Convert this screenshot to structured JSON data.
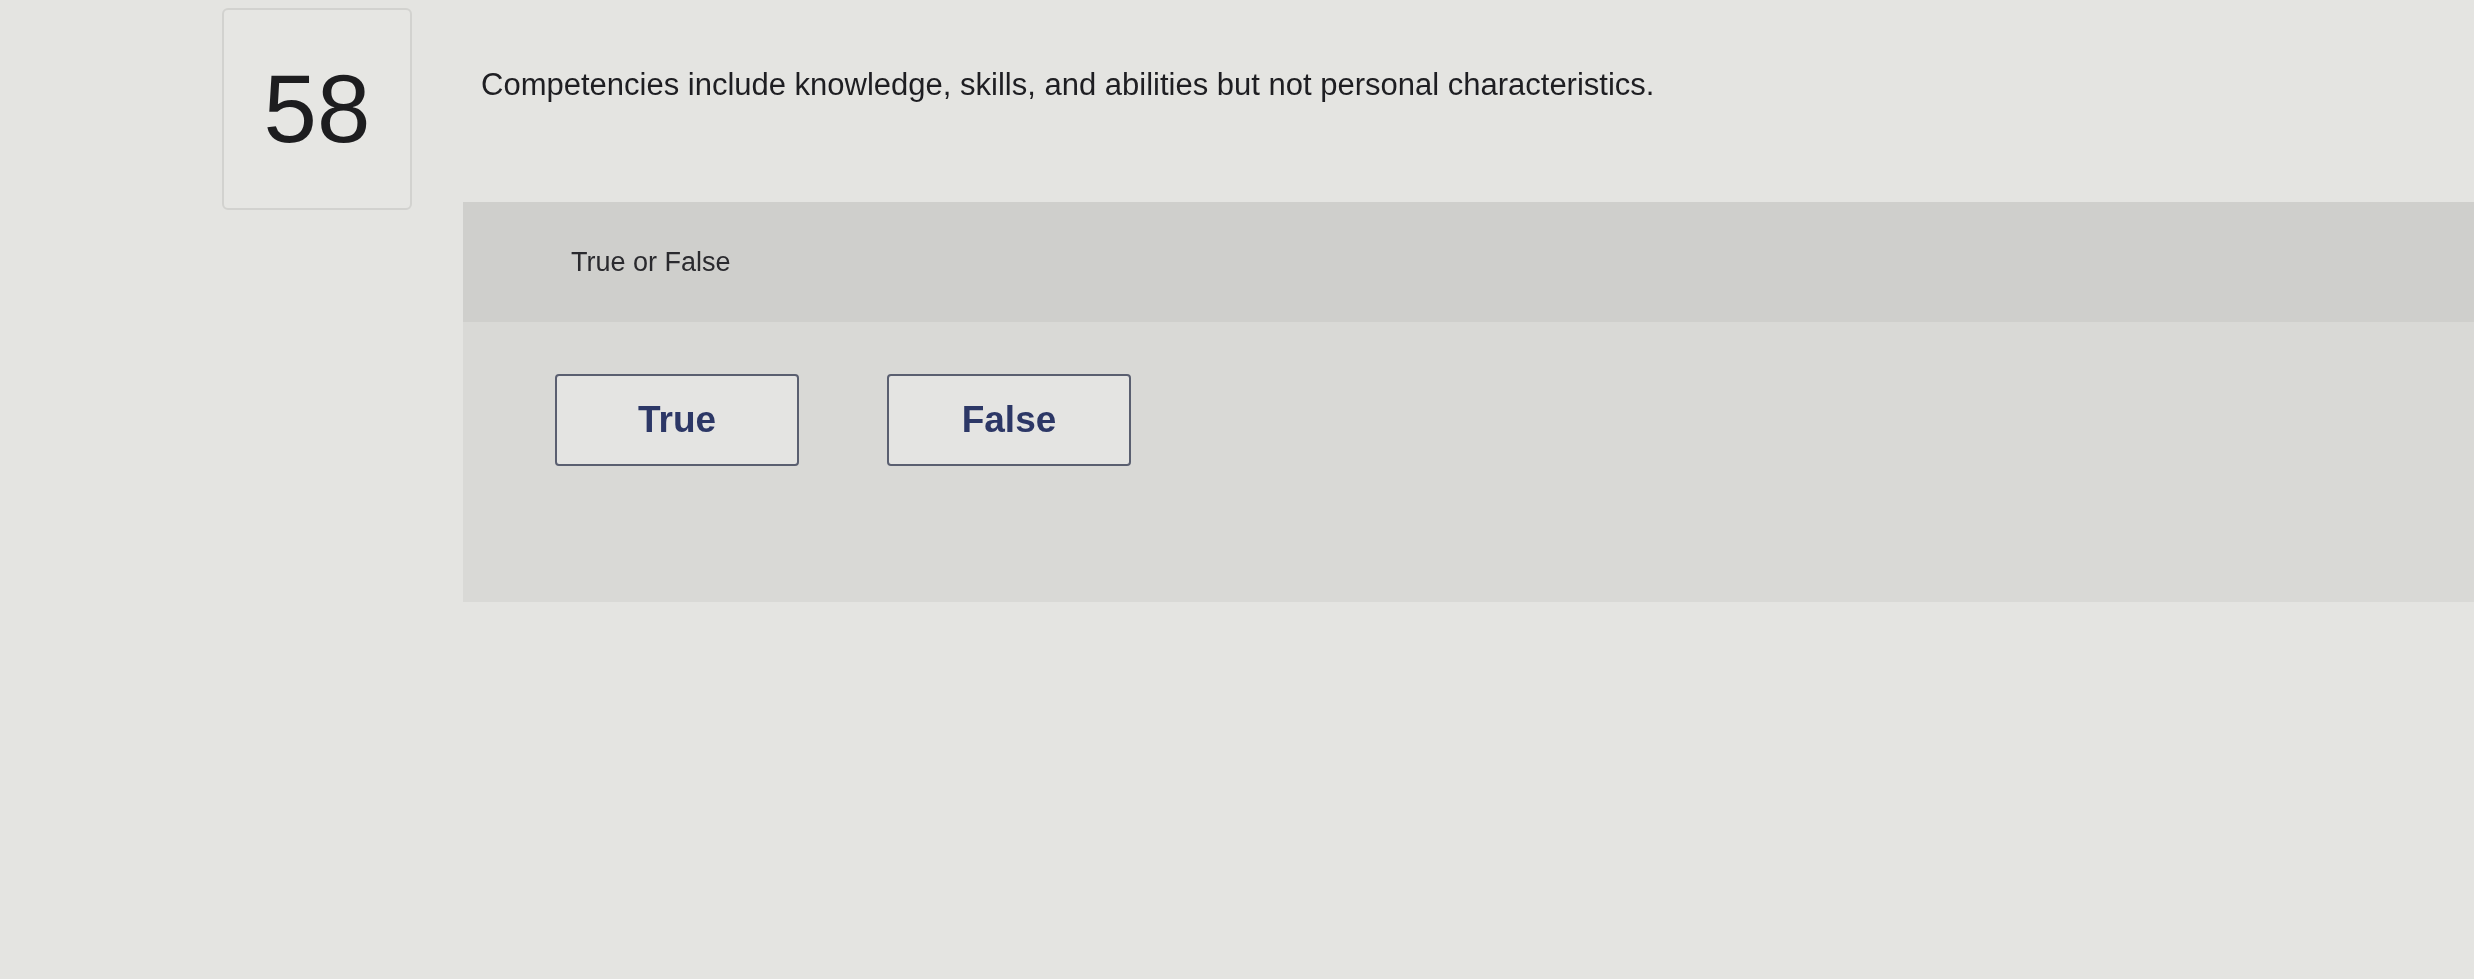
{
  "question": {
    "number": "58",
    "text": "Competencies include knowledge, skills, and abilities but not personal characteristics."
  },
  "answer_panel": {
    "prompt": "True or False",
    "options": [
      {
        "label": "True",
        "selected": false
      },
      {
        "label": "False",
        "selected": false
      }
    ]
  }
}
